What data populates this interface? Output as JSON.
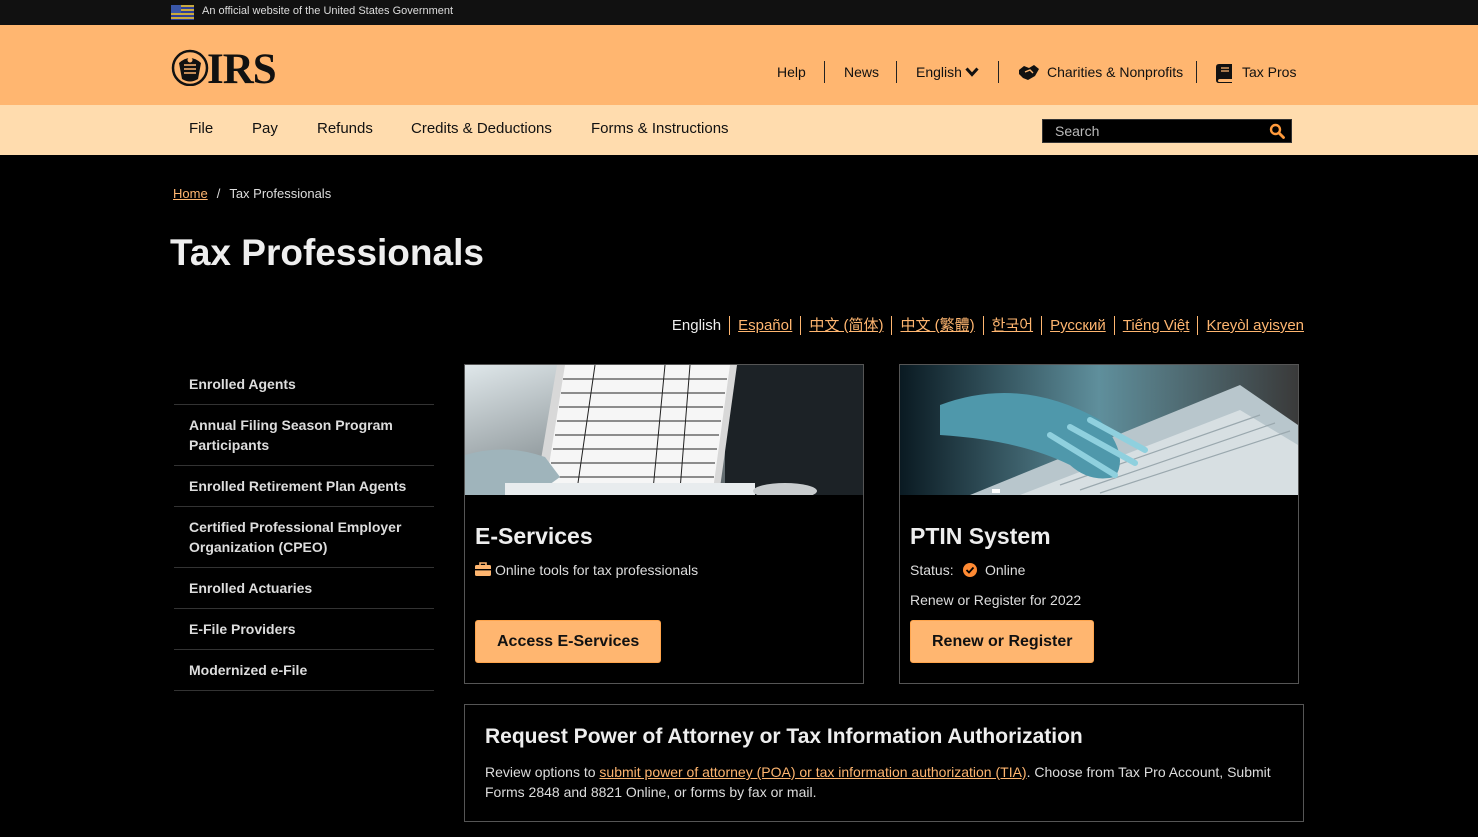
{
  "gov_banner": {
    "text": "An official website of the United States Government",
    "flag_icon": "us-flag-icon"
  },
  "header": {
    "logo_text": "IRS",
    "links": {
      "help": "Help",
      "news": "News",
      "language": "English",
      "charities": "Charities & Nonprofits",
      "tax_pros": "Tax Pros"
    },
    "icons": {
      "language_dropdown": "chevron-down-icon",
      "charities": "handshake-icon",
      "tax_pros": "book-icon"
    }
  },
  "nav": {
    "items": [
      "File",
      "Pay",
      "Refunds",
      "Credits & Deductions",
      "Forms & Instructions"
    ],
    "search_placeholder": "Search"
  },
  "breadcrumb": {
    "home": "Home",
    "separator": "/",
    "current": "Tax Professionals"
  },
  "page_title": "Tax Professionals",
  "languages": {
    "current": "English",
    "links": [
      "Español",
      "中文 (简体)",
      "中文 (繁體)",
      "한국어",
      "Русский",
      "Tiếng Việt",
      "Kreyòl ayisyen"
    ]
  },
  "sidebar": {
    "items": [
      "Enrolled Agents",
      "Annual Filing Season Program Participants",
      "Enrolled Retirement Plan Agents",
      "Certified Professional Employer Organization (CPEO)",
      "Enrolled Actuaries",
      "E-File Providers",
      "Modernized e-File"
    ]
  },
  "cards": {
    "eservices": {
      "title": "E-Services",
      "subtitle": "Online tools for tax professionals",
      "button": "Access E-Services"
    },
    "ptin": {
      "title": "PTIN System",
      "status_label": "Status:",
      "status_value": "Online",
      "description": "Renew or Register for 2022",
      "button": "Renew or Register"
    }
  },
  "poa": {
    "title": "Request Power of Attorney or Tax Information Authorization",
    "text_before": "Review options to ",
    "link": "submit power of attorney (POA) or tax information authorization (TIA)",
    "text_after": ". Choose from Tax Pro Account, Submit Forms 2848 and 8821 Online, or forms by fax or mail."
  },
  "colors": {
    "accent": "#ffb670",
    "nav_bg": "#ffdcae",
    "page_bg": "#000000",
    "banner_bg": "#111111"
  }
}
